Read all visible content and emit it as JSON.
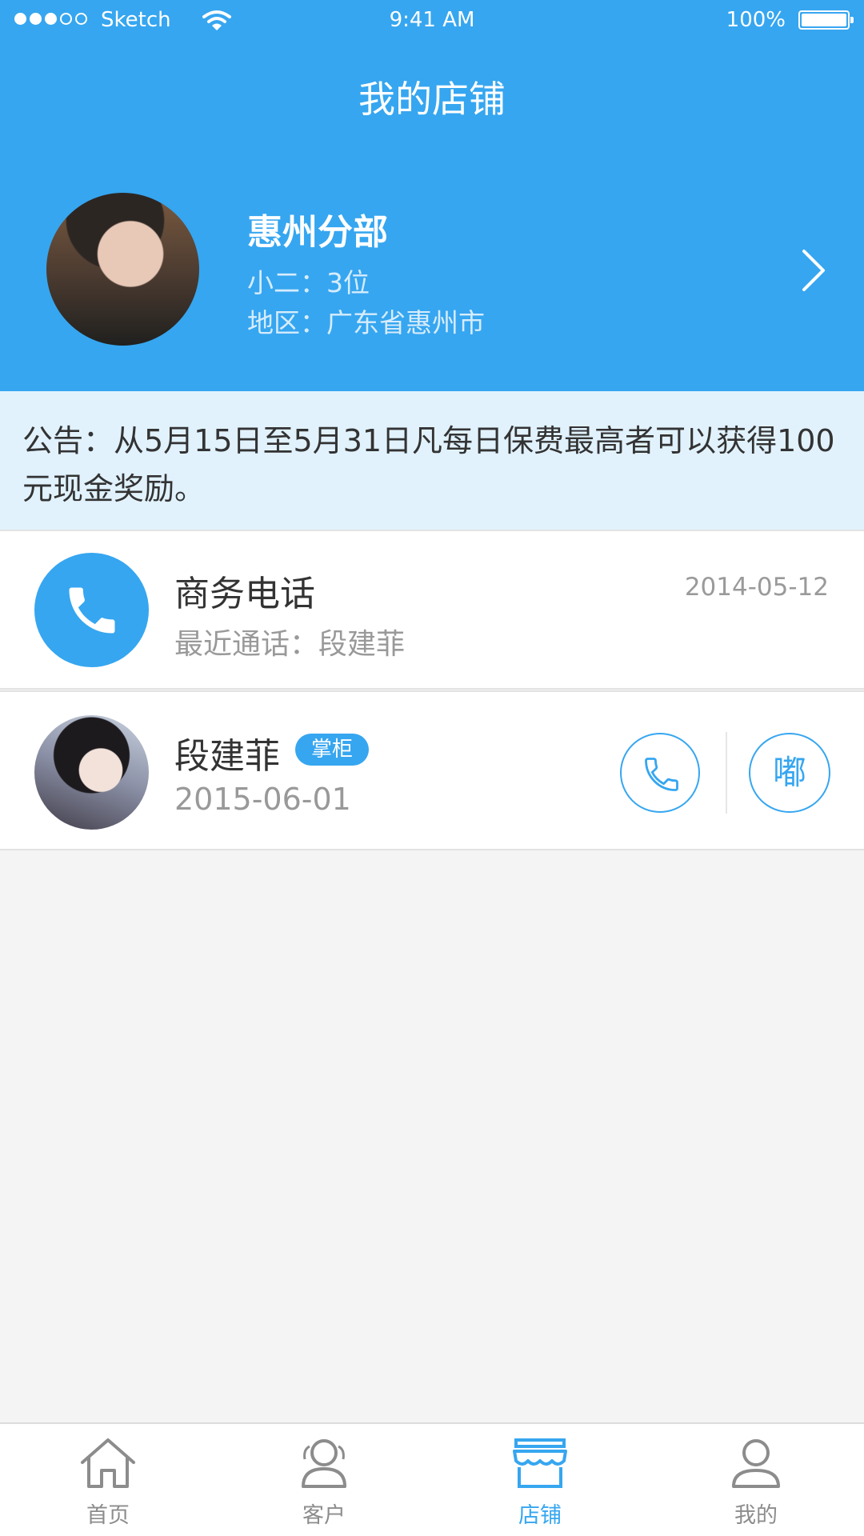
{
  "status_bar": {
    "carrier": "Sketch",
    "time": "9:41 AM",
    "battery": "100%",
    "signal_bars_filled": 3,
    "signal_bars_total": 5
  },
  "nav": {
    "title": "我的店铺"
  },
  "store": {
    "name": "惠州分部",
    "staff": "小二：3位",
    "region": "地区：广东省惠州市"
  },
  "notice": {
    "text": "公告：从5月15日至5月31日凡每日保费最高者可以获得100元现金奖励。"
  },
  "business_phone": {
    "title": "商务电话",
    "recent": "最近通话：段建菲",
    "date": "2014-05-12"
  },
  "contact": {
    "name": "段建菲",
    "role": "掌柜",
    "date": "2015-06-01",
    "chat_label": "嘟"
  },
  "tab_bar": {
    "tabs": [
      {
        "label": "首页",
        "icon": "home-icon"
      },
      {
        "label": "客户",
        "icon": "customers-icon"
      },
      {
        "label": "店铺",
        "icon": "store-icon"
      },
      {
        "label": "我的",
        "icon": "profile-icon"
      }
    ],
    "active_index": 2
  },
  "colors": {
    "primary": "#36a6f0",
    "notice_bg": "#e1f2fd",
    "page_bg": "#f4f4f4"
  }
}
